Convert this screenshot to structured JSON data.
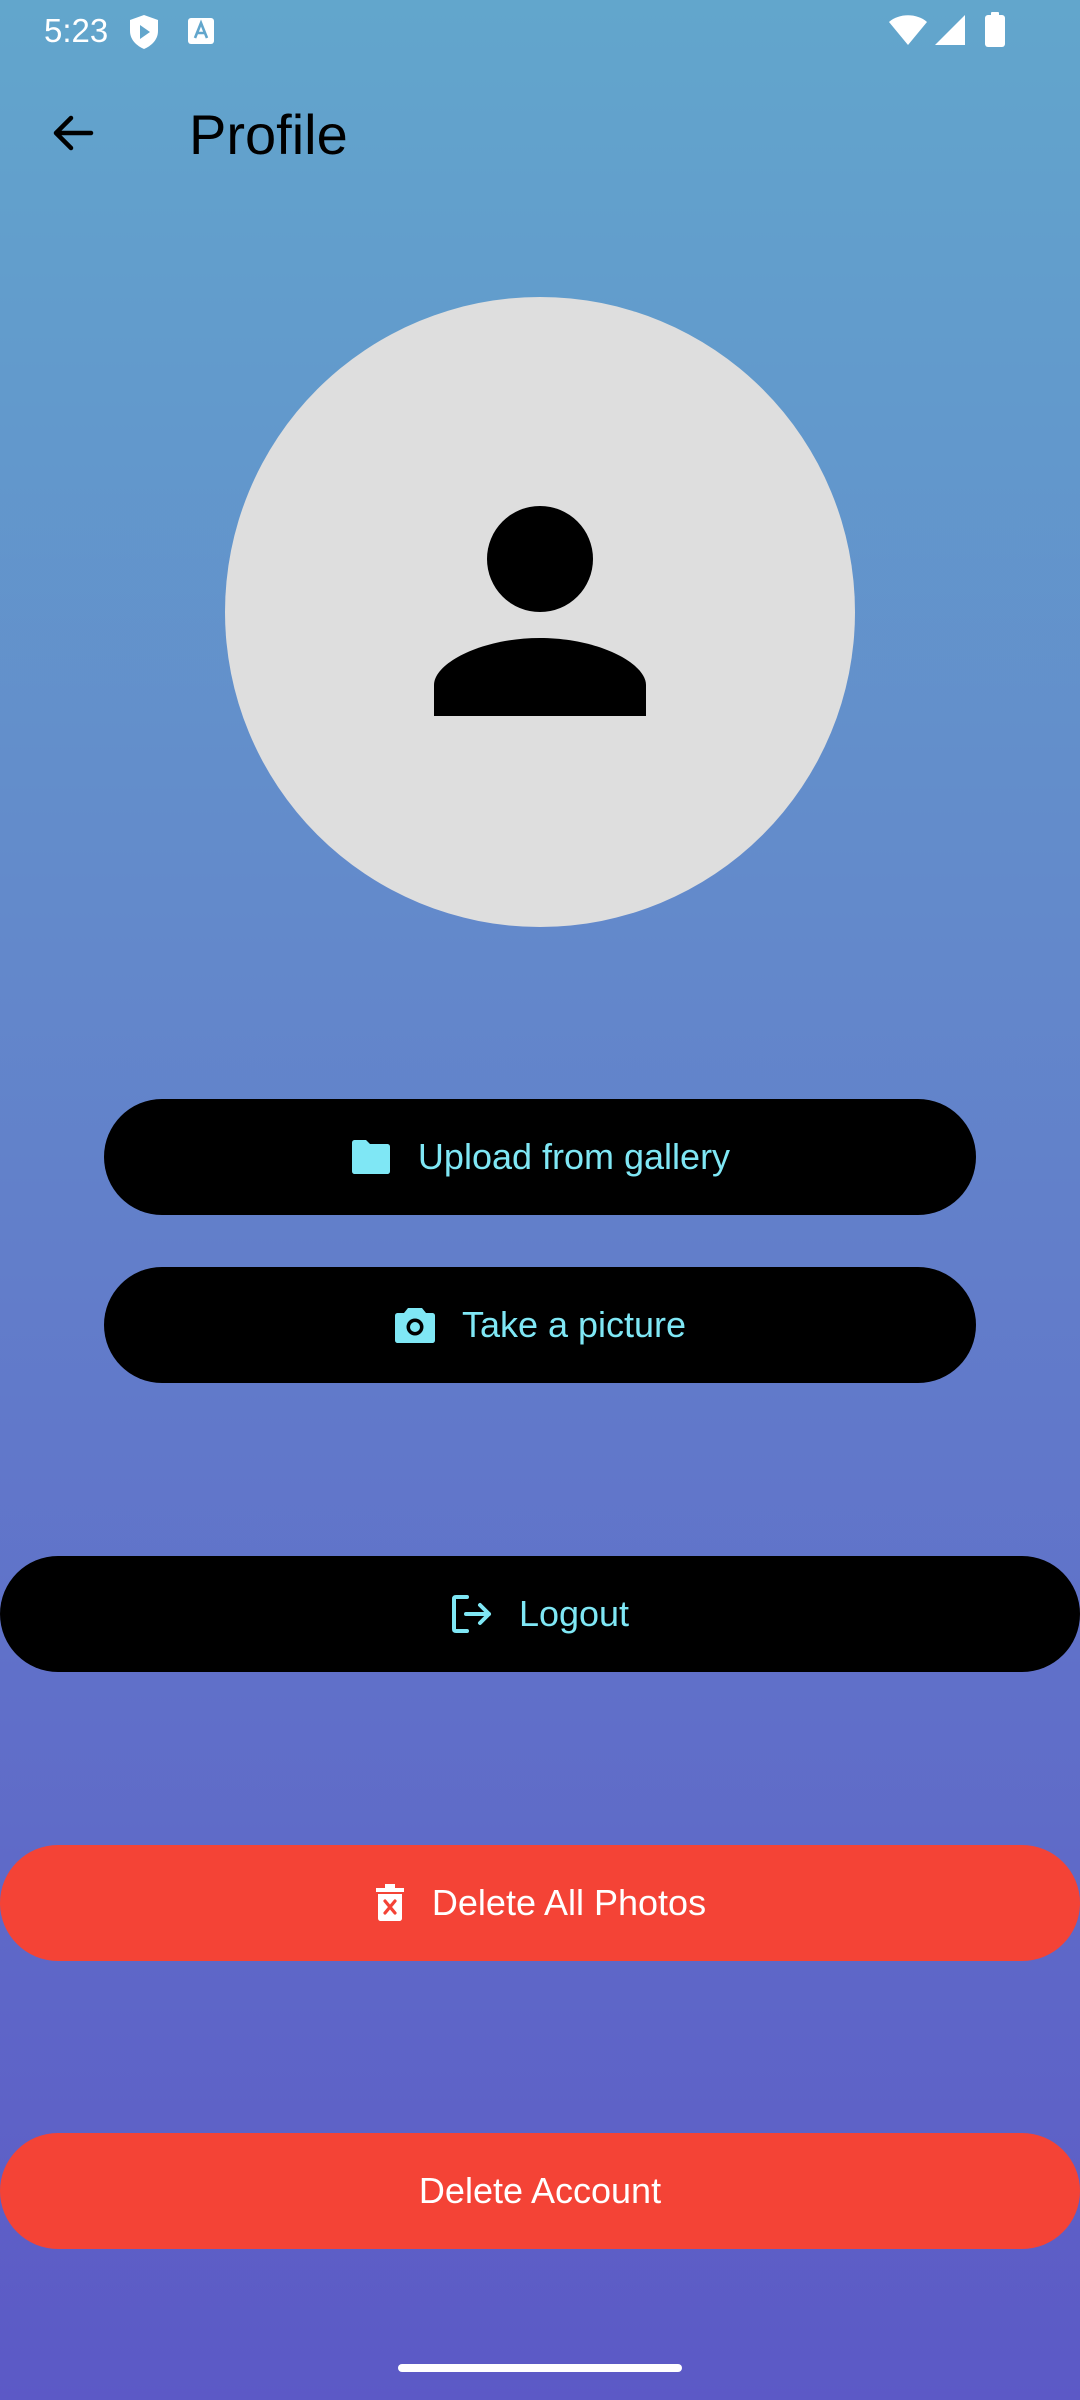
{
  "status_bar": {
    "time": "5:23",
    "left_icons": [
      "shield-play-icon",
      "a-square-icon"
    ],
    "right_icons": [
      "wifi-icon",
      "signal-icon",
      "battery-icon"
    ]
  },
  "app_bar": {
    "title": "Profile",
    "back_icon": "arrow-left-icon"
  },
  "avatar": {
    "icon": "person-icon"
  },
  "buttons": {
    "upload_gallery": {
      "label": "Upload from gallery",
      "icon": "folder-icon"
    },
    "take_picture": {
      "label": "Take a picture",
      "icon": "camera-icon"
    },
    "logout": {
      "label": "Logout",
      "icon": "logout-icon"
    },
    "delete_all_photos": {
      "label": "Delete All Photos",
      "icon": "delete-forever-icon"
    },
    "delete_account": {
      "label": "Delete Account"
    }
  },
  "colors": {
    "gradient_top": "#62a6cc",
    "gradient_bottom": "#5c59c6",
    "dark_button": "#000000",
    "dark_button_text": "#7fe7f5",
    "danger_button": "#f44336",
    "avatar_bg": "#dedede"
  }
}
